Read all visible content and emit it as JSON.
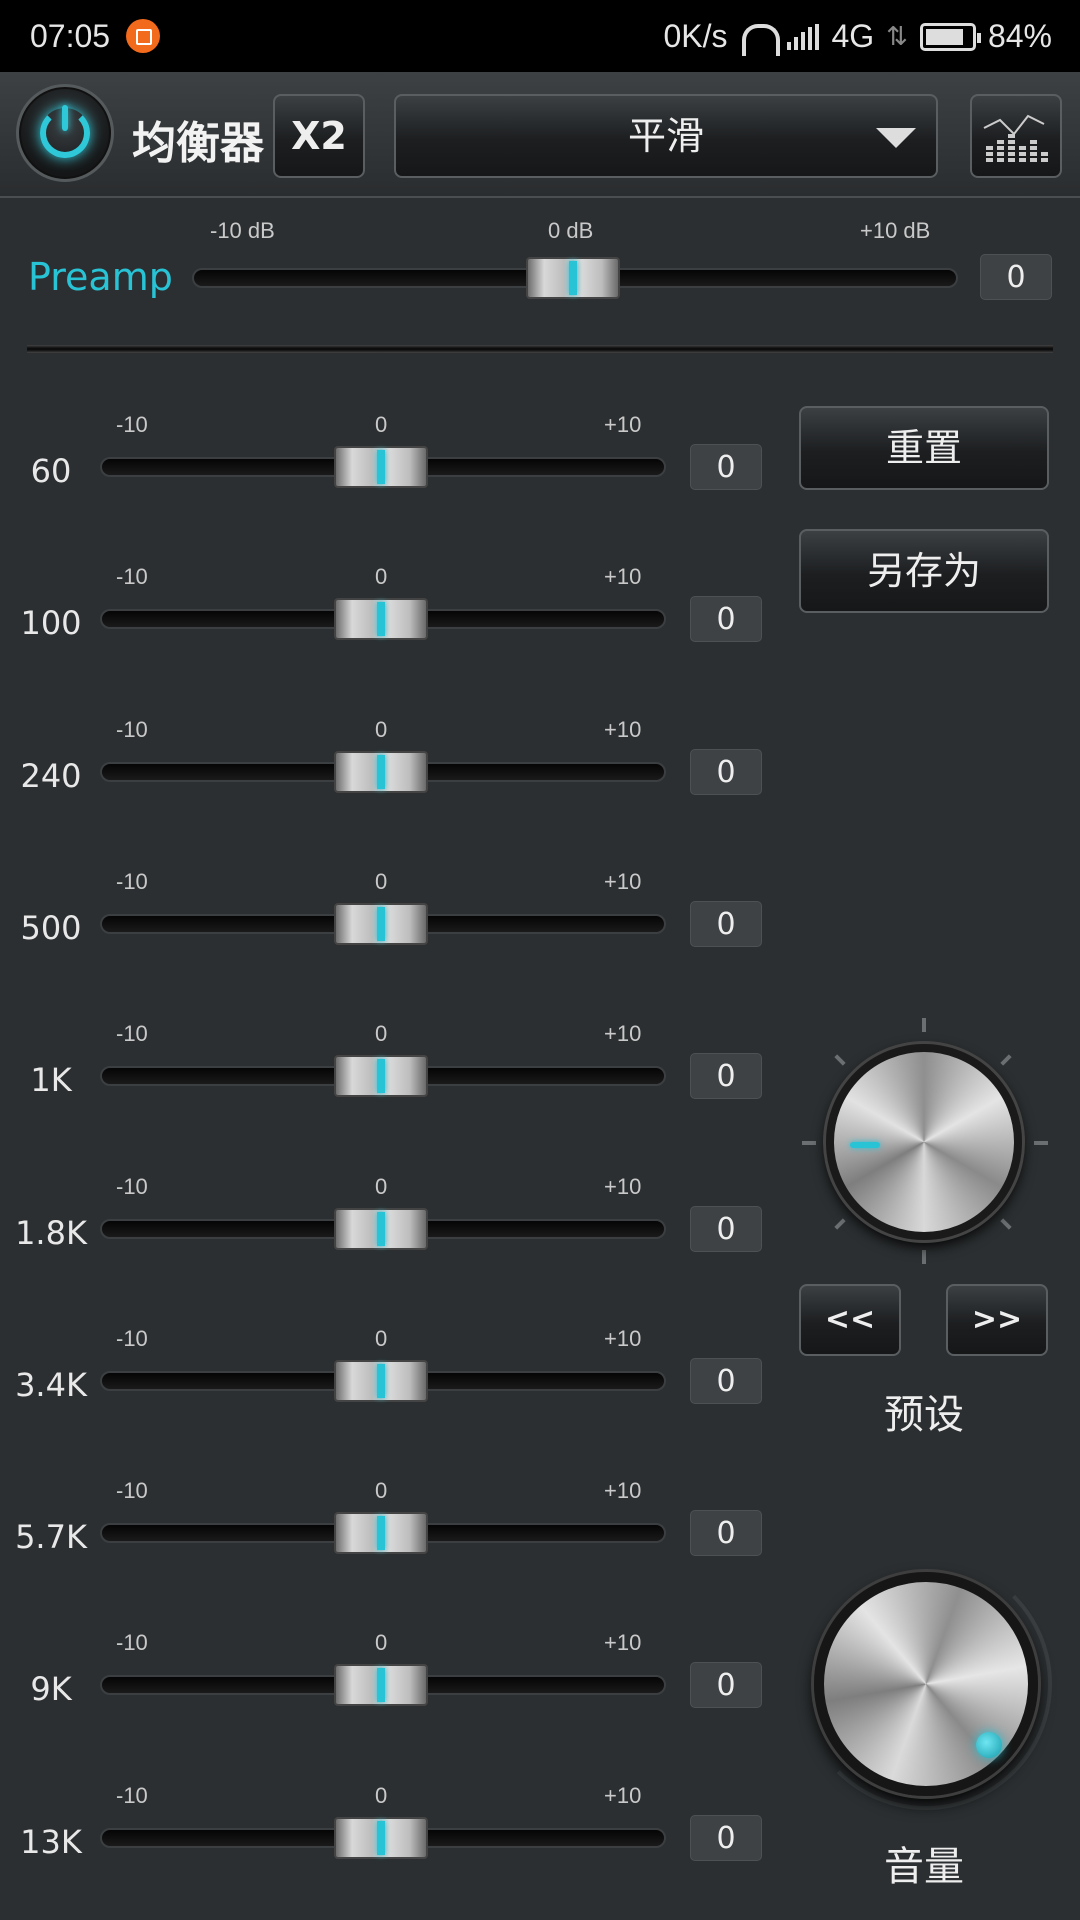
{
  "status_bar": {
    "time": "07:05",
    "network_speed": "0K/s",
    "network_type": "4G",
    "battery": "84%",
    "icons": [
      "app-notification-icon",
      "headphone-icon",
      "signal-icon",
      "data-arrows-icon",
      "battery-icon"
    ]
  },
  "toolbar": {
    "title": "均衡器",
    "x2_label": "X2",
    "preset_selected": "平滑",
    "icons": [
      "power-icon",
      "caret-down-icon",
      "spectrum-chart-icon"
    ]
  },
  "preamp": {
    "label": "Preamp",
    "scale_min": "-10 dB",
    "scale_mid": "0 dB",
    "scale_max": "+10 dB",
    "value": "0"
  },
  "band_scale": {
    "min": "-10",
    "mid": "0",
    "max": "+10"
  },
  "bands": [
    {
      "label": "60",
      "value": "0"
    },
    {
      "label": "100",
      "value": "0"
    },
    {
      "label": "240",
      "value": "0"
    },
    {
      "label": "500",
      "value": "0"
    },
    {
      "label": "1K",
      "value": "0"
    },
    {
      "label": "1.8K",
      "value": "0"
    },
    {
      "label": "3.4K",
      "value": "0"
    },
    {
      "label": "5.7K",
      "value": "0"
    },
    {
      "label": "9K",
      "value": "0"
    },
    {
      "label": "13K",
      "value": "0"
    }
  ],
  "side": {
    "reset_label": "重置",
    "save_as_label": "另存为",
    "prev_label": "<<",
    "next_label": ">>",
    "preset_label": "预设",
    "volume_label": "音量"
  },
  "colors": {
    "accent": "#29c3d6",
    "background": "#2b2f31",
    "badge": "#f26a1c"
  }
}
